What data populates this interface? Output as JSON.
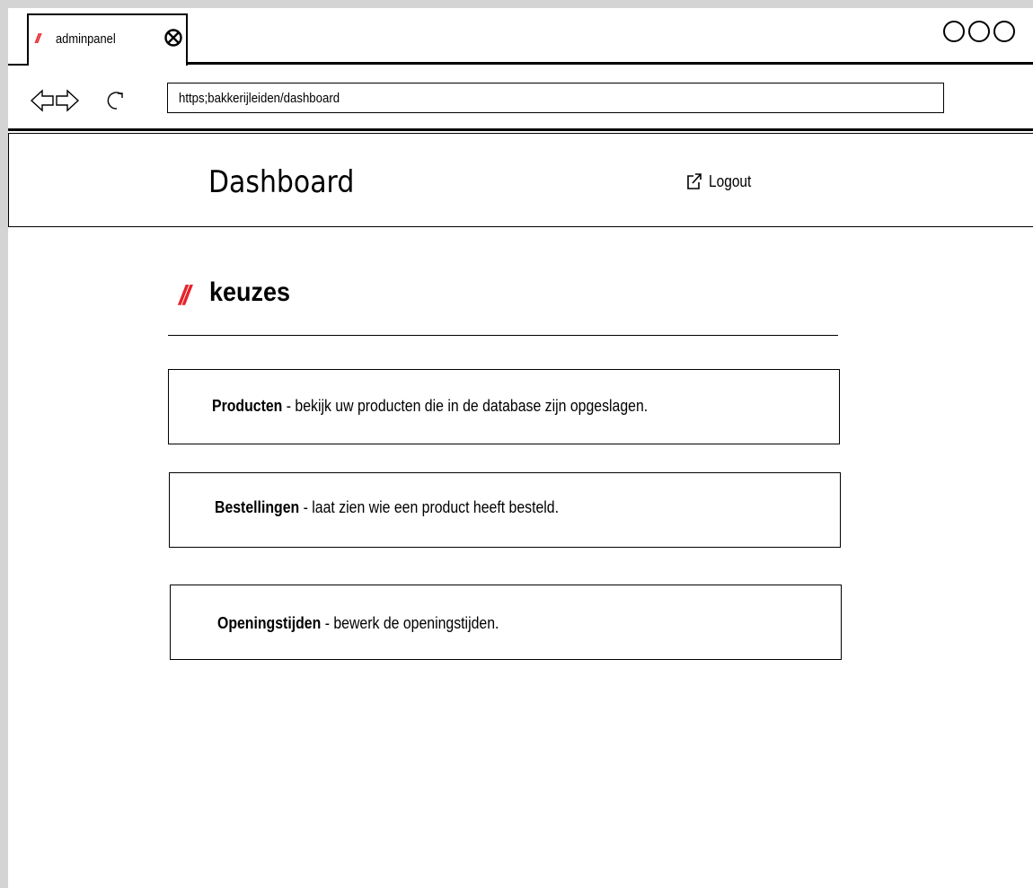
{
  "browser": {
    "tab": {
      "prefix": "//",
      "title": "adminpanel"
    },
    "url": "https;bakkerijleiden/dashboard"
  },
  "header": {
    "title": "Dashboard",
    "logout_label": "Logout"
  },
  "section": {
    "prefix": "//",
    "title": "keuzes"
  },
  "cards": [
    {
      "name": "Producten",
      "description": " - bekijk uw producten die in de database zijn opgeslagen."
    },
    {
      "name": "Bestellingen",
      "description": " - laat zien wie een product heeft besteld."
    },
    {
      "name": "Openingstijden",
      "description": " - bewerk de openingstijden."
    }
  ],
  "colors": {
    "accent": "#e8232b",
    "frame": "#d4d4d4",
    "background": "#ffffff"
  }
}
